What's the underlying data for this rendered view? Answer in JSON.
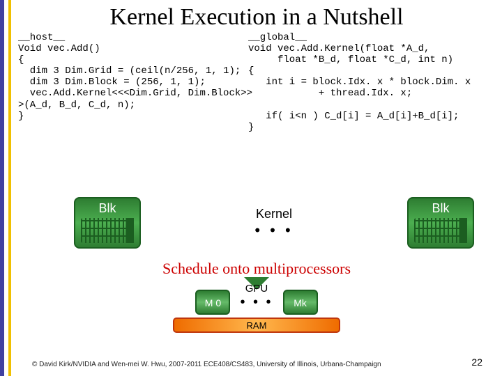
{
  "title": "Kernel Execution in a Nutshell",
  "code": {
    "host": "__host__\nVoid vec.Add()\n{\n  dim 3 Dim.Grid = (ceil(n/256, 1, 1);\n  dim 3 Dim.Block = (256, 1, 1);\n  vec.Add.Kernel<<<Dim.Grid, Dim.Block>>\n>(A_d, B_d, C_d, n);\n}",
    "global": "__global__\nvoid vec.Add.Kernel(float *A_d,\n     float *B_d, float *C_d, int n)\n{\n   int i = block.Idx. x * block.Dim. x\n            + thread.Idx. x;\n\n   if( i<n ) C_d[i] = A_d[i]+B_d[i];\n}"
  },
  "kernel": {
    "blk": "Blk",
    "label": "Kernel",
    "dots": "• • •"
  },
  "schedule": "Schedule onto multiprocessors",
  "gpu": {
    "label": "GPU",
    "m0": "M 0",
    "mk": "Mk",
    "dots": "• • •",
    "ram": "RAM"
  },
  "footer": "© David Kirk/NVIDIA and Wen-mei W. Hwu, 2007-2011\nECE408/CS483, University of Illinois, Urbana-Champaign",
  "page": "22"
}
